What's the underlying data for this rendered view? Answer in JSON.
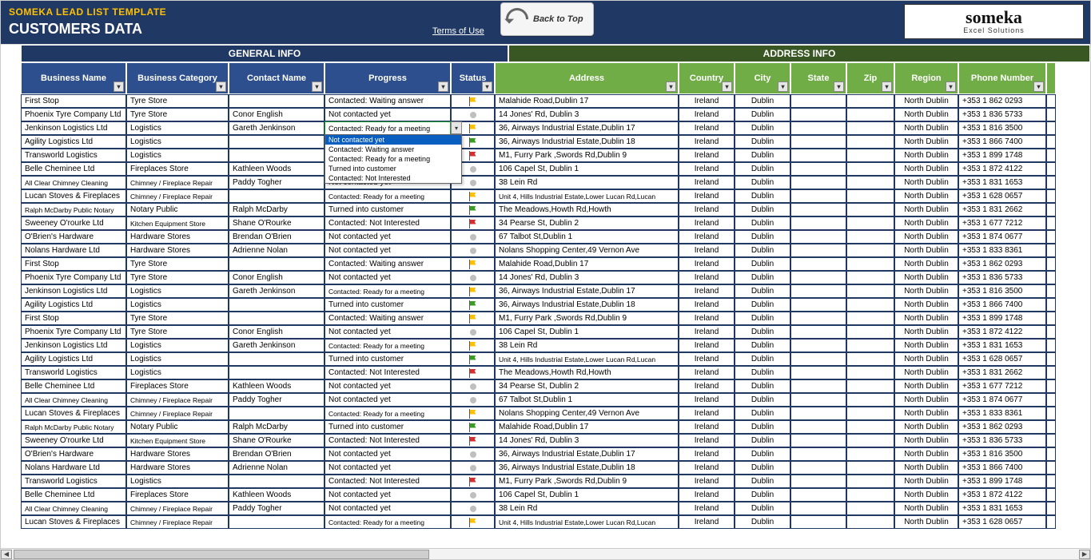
{
  "header": {
    "template_name": "SOMEKA LEAD LIST TEMPLATE",
    "page_title": "CUSTOMERS DATA",
    "terms": "Terms of Use",
    "back_label": "Back to Top",
    "logo_brand": "someka",
    "logo_tag": "Excel Solutions"
  },
  "groups": {
    "general": "GENERAL INFO",
    "address": "ADDRESS INFO"
  },
  "columns": {
    "biz": "Business Name",
    "cat": "Business Category",
    "contact": "Contact Name",
    "prog": "Progress",
    "status": "Status",
    "addr": "Address",
    "country": "Country",
    "city": "City",
    "state": "State",
    "zip": "Zip",
    "region": "Region",
    "phone": "Phone Number"
  },
  "dropdown": {
    "open_on_row": 2,
    "selected": "Not contacted yet",
    "options": [
      "Not contacted yet",
      "Contacted: Waiting answer",
      "Contacted: Ready for a meeting",
      "Turned into customer",
      "Contacted: Not Interested"
    ]
  },
  "rows": [
    {
      "biz": "First Stop",
      "cat": "Tyre Store",
      "contact": "",
      "prog": "Contacted: Waiting answer",
      "status": "yellow",
      "addr": "Malahide Road,Dublin 17",
      "country": "Ireland",
      "city": "Dublin",
      "state": "",
      "zip": "",
      "region": "North Dublin",
      "phone": "+353 1 862 0293"
    },
    {
      "biz": "Phoenix Tyre Company Ltd",
      "cat": "Tyre Store",
      "contact": "Conor English",
      "prog": "Not contacted yet",
      "status": "dot",
      "addr": "14 Jones' Rd, Dublin 3",
      "country": "Ireland",
      "city": "Dublin",
      "state": "",
      "zip": "",
      "region": "North Dublin",
      "phone": "+353 1 836 5733"
    },
    {
      "biz": "Jenkinson Logistics Ltd",
      "cat": "Logistics",
      "contact": "Gareth Jenkinson",
      "prog": "Contacted: Ready for a meeting",
      "prog_small": true,
      "status": "yellow",
      "addr": "36, Airways Industrial Estate,Dublin 17",
      "country": "Ireland",
      "city": "Dublin",
      "state": "",
      "zip": "",
      "region": "North Dublin",
      "phone": "+353 1 816 3500",
      "dropdown_open": true
    },
    {
      "biz": "Agility Logistics Ltd",
      "cat": "Logistics",
      "contact": "",
      "prog": "",
      "status": "green",
      "addr": "36, Airways Industrial Estate,Dublin 18",
      "country": "Ireland",
      "city": "Dublin",
      "state": "",
      "zip": "",
      "region": "North Dublin",
      "phone": "+353 1 866 7400"
    },
    {
      "biz": "Transworld Logistics",
      "cat": "Logistics",
      "contact": "",
      "prog": "",
      "status": "red",
      "addr": "M1, Furry Park ,Swords Rd,Dublin 9",
      "country": "Ireland",
      "city": "Dublin",
      "state": "",
      "zip": "",
      "region": "North Dublin",
      "phone": "+353 1 899 1748"
    },
    {
      "biz": "Belle Cheminee Ltd",
      "cat": "Fireplaces Store",
      "contact": "Kathleen Woods",
      "prog": "",
      "status": "dot",
      "addr": "106 Capel St, Dublin 1",
      "country": "Ireland",
      "city": "Dublin",
      "state": "",
      "zip": "",
      "region": "North Dublin",
      "phone": "+353 1 872 4122"
    },
    {
      "biz": "All Clear Chimney Cleaning",
      "biz_small": true,
      "cat": "Chimney / Fireplace Repair",
      "cat_small": true,
      "contact": "Paddy Togher",
      "prog": "Not contacted yet",
      "status": "dot",
      "addr": "38 Lein Rd",
      "country": "Ireland",
      "city": "Dublin",
      "state": "",
      "zip": "",
      "region": "North Dublin",
      "phone": "+353 1 831 1653"
    },
    {
      "biz": "Lucan Stoves & Fireplaces",
      "cat": "Chimney / Fireplace Repair",
      "cat_small": true,
      "contact": "",
      "prog": "Contacted: Ready for a meeting",
      "prog_small": true,
      "status": "yellow",
      "addr": "Unit 4, Hills Industrial Estate,Lower Lucan Rd,Lucan",
      "addr_small": true,
      "country": "Ireland",
      "city": "Dublin",
      "state": "",
      "zip": "",
      "region": "North Dublin",
      "phone": "+353 1 628 0657"
    },
    {
      "biz": "Ralph McDarby Public Notary",
      "biz_small": true,
      "cat": "Notary Public",
      "contact": "Ralph McDarby",
      "prog": "Turned into customer",
      "status": "green",
      "addr": "The Meadows,Howth Rd,Howth",
      "country": "Ireland",
      "city": "Dublin",
      "state": "",
      "zip": "",
      "region": "North Dublin",
      "phone": "+353 1 831 2662"
    },
    {
      "biz": "Sweeney O'rourke Ltd",
      "cat": "Kitchen Equipment Store",
      "cat_small": true,
      "contact": "Shane O'Rourke",
      "prog": "Contacted: Not Interested",
      "status": "red",
      "addr": "34 Pearse St, Dublin 2",
      "country": "Ireland",
      "city": "Dublin",
      "state": "",
      "zip": "",
      "region": "North Dublin",
      "phone": "+353 1 677 7212"
    },
    {
      "biz": "O'Brien's Hardware",
      "cat": "Hardware Stores",
      "contact": "Brendan O'Brien",
      "prog": "Not contacted yet",
      "status": "dot",
      "addr": "67 Talbot St,Dublin 1",
      "country": "Ireland",
      "city": "Dublin",
      "state": "",
      "zip": "",
      "region": "North Dublin",
      "phone": "+353 1 874 0677"
    },
    {
      "biz": "Nolans Hardware Ltd",
      "cat": "Hardware Stores",
      "contact": "Adrienne Nolan",
      "prog": "Not contacted yet",
      "status": "dot",
      "addr": "Nolans Shopping Center,49 Vernon Ave",
      "country": "Ireland",
      "city": "Dublin",
      "state": "",
      "zip": "",
      "region": "North Dublin",
      "phone": "+353 1 833 8361"
    },
    {
      "biz": "First Stop",
      "cat": "Tyre Store",
      "contact": "",
      "prog": "Contacted: Waiting answer",
      "status": "yellow",
      "addr": "Malahide Road,Dublin 17",
      "country": "Ireland",
      "city": "Dublin",
      "state": "",
      "zip": "",
      "region": "North Dublin",
      "phone": "+353 1 862 0293"
    },
    {
      "biz": "Phoenix Tyre Company Ltd",
      "cat": "Tyre Store",
      "contact": "Conor English",
      "prog": "Not contacted yet",
      "status": "dot",
      "addr": "14 Jones' Rd, Dublin 3",
      "country": "Ireland",
      "city": "Dublin",
      "state": "",
      "zip": "",
      "region": "North Dublin",
      "phone": "+353 1 836 5733"
    },
    {
      "biz": "Jenkinson Logistics Ltd",
      "cat": "Logistics",
      "contact": "Gareth Jenkinson",
      "prog": "Contacted: Ready for a meeting",
      "prog_small": true,
      "status": "yellow",
      "addr": "36, Airways Industrial Estate,Dublin 17",
      "country": "Ireland",
      "city": "Dublin",
      "state": "",
      "zip": "",
      "region": "North Dublin",
      "phone": "+353 1 816 3500"
    },
    {
      "biz": "Agility Logistics Ltd",
      "cat": "Logistics",
      "contact": "",
      "prog": "Turned into customer",
      "status": "green",
      "addr": "36, Airways Industrial Estate,Dublin 18",
      "country": "Ireland",
      "city": "Dublin",
      "state": "",
      "zip": "",
      "region": "North Dublin",
      "phone": "+353 1 866 7400"
    },
    {
      "biz": "First Stop",
      "cat": "Tyre Store",
      "contact": "",
      "prog": "Contacted: Waiting answer",
      "status": "yellow",
      "addr": "M1, Furry Park ,Swords Rd,Dublin 9",
      "country": "Ireland",
      "city": "Dublin",
      "state": "",
      "zip": "",
      "region": "North Dublin",
      "phone": "+353 1 899 1748"
    },
    {
      "biz": "Phoenix Tyre Company Ltd",
      "cat": "Tyre Store",
      "contact": "Conor English",
      "prog": "Not contacted yet",
      "status": "dot",
      "addr": "106 Capel St, Dublin 1",
      "country": "Ireland",
      "city": "Dublin",
      "state": "",
      "zip": "",
      "region": "North Dublin",
      "phone": "+353 1 872 4122"
    },
    {
      "biz": "Jenkinson Logistics Ltd",
      "cat": "Logistics",
      "contact": "Gareth Jenkinson",
      "prog": "Contacted: Ready for a meeting",
      "prog_small": true,
      "status": "yellow",
      "addr": "38 Lein Rd",
      "country": "Ireland",
      "city": "Dublin",
      "state": "",
      "zip": "",
      "region": "North Dublin",
      "phone": "+353 1 831 1653"
    },
    {
      "biz": "Agility Logistics Ltd",
      "cat": "Logistics",
      "contact": "",
      "prog": "Turned into customer",
      "status": "green",
      "addr": "Unit 4, Hills Industrial Estate,Lower Lucan Rd,Lucan",
      "addr_small": true,
      "country": "Ireland",
      "city": "Dublin",
      "state": "",
      "zip": "",
      "region": "North Dublin",
      "phone": "+353 1 628 0657"
    },
    {
      "biz": "Transworld Logistics",
      "cat": "Logistics",
      "contact": "",
      "prog": "Contacted: Not Interested",
      "status": "red",
      "addr": "The Meadows,Howth Rd,Howth",
      "country": "Ireland",
      "city": "Dublin",
      "state": "",
      "zip": "",
      "region": "North Dublin",
      "phone": "+353 1 831 2662"
    },
    {
      "biz": "Belle Cheminee Ltd",
      "cat": "Fireplaces Store",
      "contact": "Kathleen Woods",
      "prog": "Not contacted yet",
      "status": "dot",
      "addr": "34 Pearse St, Dublin 2",
      "country": "Ireland",
      "city": "Dublin",
      "state": "",
      "zip": "",
      "region": "North Dublin",
      "phone": "+353 1 677 7212"
    },
    {
      "biz": "All Clear Chimney Cleaning",
      "biz_small": true,
      "cat": "Chimney / Fireplace Repair",
      "cat_small": true,
      "contact": "Paddy Togher",
      "prog": "Not contacted yet",
      "status": "dot",
      "addr": "67 Talbot St,Dublin 1",
      "country": "Ireland",
      "city": "Dublin",
      "state": "",
      "zip": "",
      "region": "North Dublin",
      "phone": "+353 1 874 0677"
    },
    {
      "biz": "Lucan Stoves & Fireplaces",
      "cat": "Chimney / Fireplace Repair",
      "cat_small": true,
      "contact": "",
      "prog": "Contacted: Ready for a meeting",
      "prog_small": true,
      "status": "yellow",
      "addr": "Nolans Shopping Center,49 Vernon Ave",
      "country": "Ireland",
      "city": "Dublin",
      "state": "",
      "zip": "",
      "region": "North Dublin",
      "phone": "+353 1 833 8361"
    },
    {
      "biz": "Ralph McDarby Public Notary",
      "biz_small": true,
      "cat": "Notary Public",
      "contact": "Ralph McDarby",
      "prog": "Turned into customer",
      "status": "green",
      "addr": "Malahide Road,Dublin 17",
      "country": "Ireland",
      "city": "Dublin",
      "state": "",
      "zip": "",
      "region": "North Dublin",
      "phone": "+353 1 862 0293"
    },
    {
      "biz": "Sweeney O'rourke Ltd",
      "cat": "Kitchen Equipment Store",
      "cat_small": true,
      "contact": "Shane O'Rourke",
      "prog": "Contacted: Not Interested",
      "status": "red",
      "addr": "14 Jones' Rd, Dublin 3",
      "country": "Ireland",
      "city": "Dublin",
      "state": "",
      "zip": "",
      "region": "North Dublin",
      "phone": "+353 1 836 5733"
    },
    {
      "biz": "O'Brien's Hardware",
      "cat": "Hardware Stores",
      "contact": "Brendan O'Brien",
      "prog": "Not contacted yet",
      "status": "dot",
      "addr": "36, Airways Industrial Estate,Dublin 17",
      "country": "Ireland",
      "city": "Dublin",
      "state": "",
      "zip": "",
      "region": "North Dublin",
      "phone": "+353 1 816 3500"
    },
    {
      "biz": "Nolans Hardware Ltd",
      "cat": "Hardware Stores",
      "contact": "Adrienne Nolan",
      "prog": "Not contacted yet",
      "status": "dot",
      "addr": "36, Airways Industrial Estate,Dublin 18",
      "country": "Ireland",
      "city": "Dublin",
      "state": "",
      "zip": "",
      "region": "North Dublin",
      "phone": "+353 1 866 7400"
    },
    {
      "biz": "Transworld Logistics",
      "cat": "Logistics",
      "contact": "",
      "prog": "Contacted: Not Interested",
      "status": "red",
      "addr": "M1, Furry Park ,Swords Rd,Dublin 9",
      "country": "Ireland",
      "city": "Dublin",
      "state": "",
      "zip": "",
      "region": "North Dublin",
      "phone": "+353 1 899 1748"
    },
    {
      "biz": "Belle Cheminee Ltd",
      "cat": "Fireplaces Store",
      "contact": "Kathleen Woods",
      "prog": "Not contacted yet",
      "status": "dot",
      "addr": "106 Capel St, Dublin 1",
      "country": "Ireland",
      "city": "Dublin",
      "state": "",
      "zip": "",
      "region": "North Dublin",
      "phone": "+353 1 872 4122"
    },
    {
      "biz": "All Clear Chimney Cleaning",
      "biz_small": true,
      "cat": "Chimney / Fireplace Repair",
      "cat_small": true,
      "contact": "Paddy Togher",
      "prog": "Not contacted yet",
      "status": "dot",
      "addr": "38 Lein Rd",
      "country": "Ireland",
      "city": "Dublin",
      "state": "",
      "zip": "",
      "region": "North Dublin",
      "phone": "+353 1 831 1653"
    },
    {
      "biz": "Lucan Stoves & Fireplaces",
      "cat": "Chimney / Fireplace Repair",
      "cat_small": true,
      "contact": "",
      "prog": "Contacted: Ready for a meeting",
      "prog_small": true,
      "status": "yellow",
      "addr": "Unit 4, Hills Industrial Estate,Lower Lucan Rd,Lucan",
      "addr_small": true,
      "country": "Ireland",
      "city": "Dublin",
      "state": "",
      "zip": "",
      "region": "North Dublin",
      "phone": "+353 1 628 0657"
    }
  ]
}
